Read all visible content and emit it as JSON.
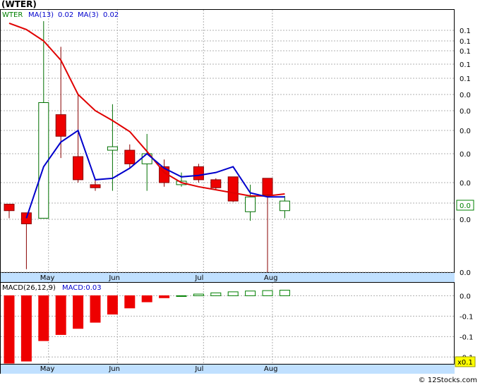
{
  "title": "(WTER)",
  "footer": "© 12Stocks.com",
  "colors": {
    "ma13": "#e00000",
    "ma3": "#0000cc",
    "legend_ticker": "#008000",
    "legend_text": "#0000cc",
    "up_edge": "#007000",
    "down_fill": "#ee0000",
    "axis_band": "#c0e0ff",
    "grid": "#b0b0b0",
    "macd_up": "#008000",
    "macd_down": "#ee0000",
    "highlight": "#ffff00"
  },
  "chart_data": [
    {
      "type": "candlestick",
      "ticker": "WTER",
      "legend": {
        "ticker": "WTER",
        "ma13": "MA(13)",
        "ma13_value": "0.02",
        "ma3": "MA(3)",
        "ma3_value": "0.02"
      },
      "x_ticks": [
        "May",
        "Jun",
        "Jul",
        "Aug"
      ],
      "x_tick_index": [
        1.3,
        5.3,
        10.3,
        14.3
      ],
      "y_tick_labels": [
        "0.1",
        "0.1",
        "0.1",
        "0.1",
        "0.1",
        "0.0",
        "0.0",
        "0.0",
        "0.0",
        "0.0",
        "0.0",
        "0.0",
        "0.0"
      ],
      "y_tick_values": [
        0.04,
        0.038,
        0.036,
        0.034,
        0.032,
        0.03,
        0.028,
        0.026,
        0.024,
        0.022,
        0.02,
        0.0185,
        0.015
      ],
      "last_price_label": "0.0",
      "last_price_value": 0.0195,
      "ylim": [
        0.015,
        0.044
      ],
      "candles": [
        {
          "o": 0.0199,
          "h": 0.0199,
          "l": 0.0186,
          "c": 0.0193
        },
        {
          "o": 0.0191,
          "h": 0.0191,
          "l": 0.0152,
          "c": 0.0182
        },
        {
          "o": 0.0186,
          "h": 0.0448,
          "l": 0.0186,
          "c": 0.029
        },
        {
          "o": 0.0276,
          "h": 0.0368,
          "l": 0.0237,
          "c": 0.0255
        },
        {
          "o": 0.0238,
          "h": 0.03,
          "l": 0.022,
          "c": 0.0222
        },
        {
          "o": 0.0218,
          "h": 0.0222,
          "l": 0.0212,
          "c": 0.0215
        },
        {
          "o": 0.0243,
          "h": 0.0288,
          "l": 0.0212,
          "c": 0.0246
        },
        {
          "o": 0.0243,
          "h": 0.0248,
          "l": 0.023,
          "c": 0.0233
        },
        {
          "o": 0.0233,
          "h": 0.0257,
          "l": 0.0212,
          "c": 0.024
        },
        {
          "o": 0.0231,
          "h": 0.0236,
          "l": 0.0216,
          "c": 0.022
        },
        {
          "o": 0.0218,
          "h": 0.0227,
          "l": 0.0216,
          "c": 0.0221
        },
        {
          "o": 0.0231,
          "h": 0.0233,
          "l": 0.022,
          "c": 0.0222
        },
        {
          "o": 0.0222,
          "h": 0.0223,
          "l": 0.0213,
          "c": 0.0215
        },
        {
          "o": 0.0224,
          "h": 0.0224,
          "l": 0.0201,
          "c": 0.0202
        },
        {
          "o": 0.0192,
          "h": 0.0218,
          "l": 0.0184,
          "c": 0.0206
        },
        {
          "o": 0.0223,
          "h": 0.0223,
          "l": 0.015,
          "c": 0.0208
        },
        {
          "o": 0.0193,
          "h": 0.0207,
          "l": 0.0186,
          "c": 0.0202
        }
      ],
      "series": [
        {
          "name": "MA(13)",
          "values": [
            0.0437,
            0.0404,
            0.038,
            0.0346,
            0.03,
            0.028,
            0.027,
            0.0259,
            0.0242,
            0.0227,
            0.022,
            0.0216,
            0.0213,
            0.021,
            0.0207,
            0.0207,
            0.0209
          ]
        },
        {
          "name": "MA(3)",
          "values": [
            null,
            0.0186,
            0.0231,
            0.025,
            0.026,
            0.0222,
            0.0223,
            0.023,
            0.024,
            0.023,
            0.0224,
            0.0225,
            0.0227,
            0.0231,
            0.021,
            0.0206,
            0.0206
          ]
        }
      ]
    },
    {
      "type": "bar",
      "name": "MACD panel",
      "legend": {
        "label": "MACD(26,12,9)",
        "value_label": "MACD:0.03"
      },
      "x_ticks": [
        "May",
        "Jun",
        "Jul",
        "Aug"
      ],
      "y_tick_labels": [
        "0.0",
        "-0.1",
        "-0.1",
        "-0.1"
      ],
      "y_tick_values": [
        0.0,
        -0.01,
        -0.02,
        -0.03
      ],
      "multiplier_label": "x0.1",
      "ylim": [
        -0.033,
        0.006
      ],
      "values": [
        -0.033,
        -0.032,
        -0.022,
        -0.019,
        -0.016,
        -0.013,
        -0.009,
        -0.006,
        -0.003,
        -0.001,
        0.0,
        0.0008,
        0.0014,
        0.0019,
        0.0023,
        0.0025,
        0.0027
      ]
    }
  ]
}
